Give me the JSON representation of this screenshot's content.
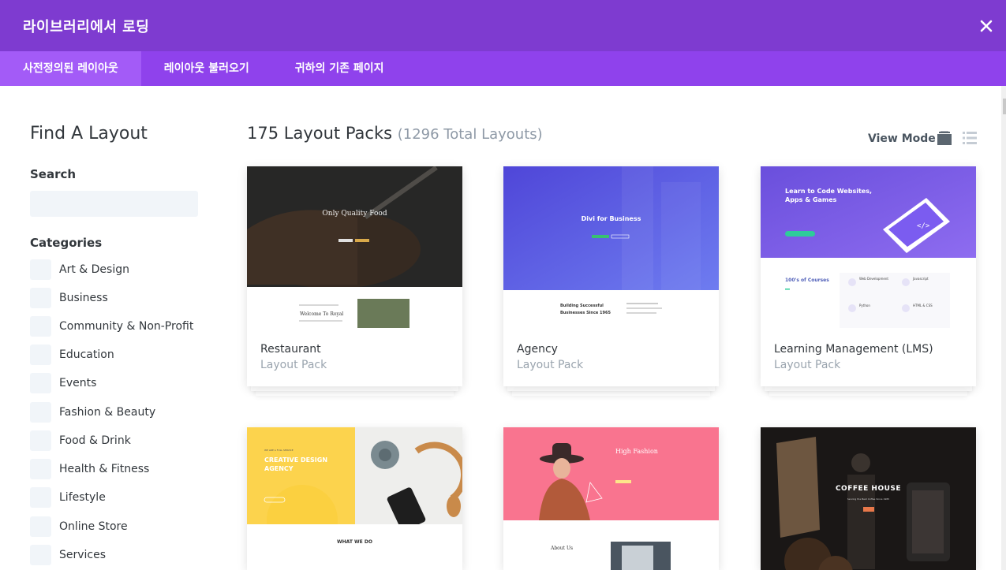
{
  "modal": {
    "title": "라이브러리에서 로딩",
    "close_icon": "close-icon"
  },
  "tabs": [
    {
      "label": "사전정의된 레이아웃",
      "active": true
    },
    {
      "label": "레이아웃 불러오기",
      "active": false
    },
    {
      "label": "귀하의 기존 페이지",
      "active": false
    }
  ],
  "sidebar": {
    "title": "Find A Layout",
    "search_label": "Search",
    "search_value": "",
    "categories_label": "Categories",
    "categories": [
      "Art & Design",
      "Business",
      "Community & Non-Profit",
      "Education",
      "Events",
      "Fashion & Beauty",
      "Food & Drink",
      "Health & Fitness",
      "Lifestyle",
      "Online Store",
      "Services"
    ]
  },
  "main": {
    "count_label": "175 Layout Packs",
    "total_label": "(1296 Total Layouts)",
    "view_mode_label": "View Mode",
    "view_mode_icons": [
      "grid-view-icon",
      "list-view-icon"
    ]
  },
  "layouts": [
    {
      "name": "Restaurant",
      "type": "Layout Pack",
      "thumb": {
        "hero_title": "Only Quality Food",
        "section_title": "Welcome To Royal"
      }
    },
    {
      "name": "Agency",
      "type": "Layout Pack",
      "thumb": {
        "hero_title": "Divi for Business",
        "section_title": "Building Successful Businesses Since 1965"
      }
    },
    {
      "name": "Learning Management (LMS)",
      "type": "Layout Pack",
      "thumb": {
        "hero_title": "Learn to Code Websites, Apps & Games",
        "section_title": "100's of Courses",
        "features": [
          "Web Development",
          "Javascript",
          "Python",
          "HTML & CSS"
        ]
      }
    },
    {
      "name": "",
      "type": "",
      "thumb": {
        "hero_small": "WE ARE A FULL SERVICE",
        "hero_title": "CREATIVE DESIGN AGENCY",
        "section_title": "WHAT WE DO"
      }
    },
    {
      "name": "",
      "type": "",
      "thumb": {
        "hero_title": "High Fashion",
        "section_title": "About Us"
      }
    },
    {
      "name": "",
      "type": "",
      "thumb": {
        "hero_title": "COFFEE HOUSE",
        "hero_sub": "Serving the Best Coffee Since 1985"
      }
    }
  ],
  "colors": {
    "header": "#7e3bd0",
    "tabs": "#8f42ec",
    "active_tab": "#a35bf7"
  }
}
